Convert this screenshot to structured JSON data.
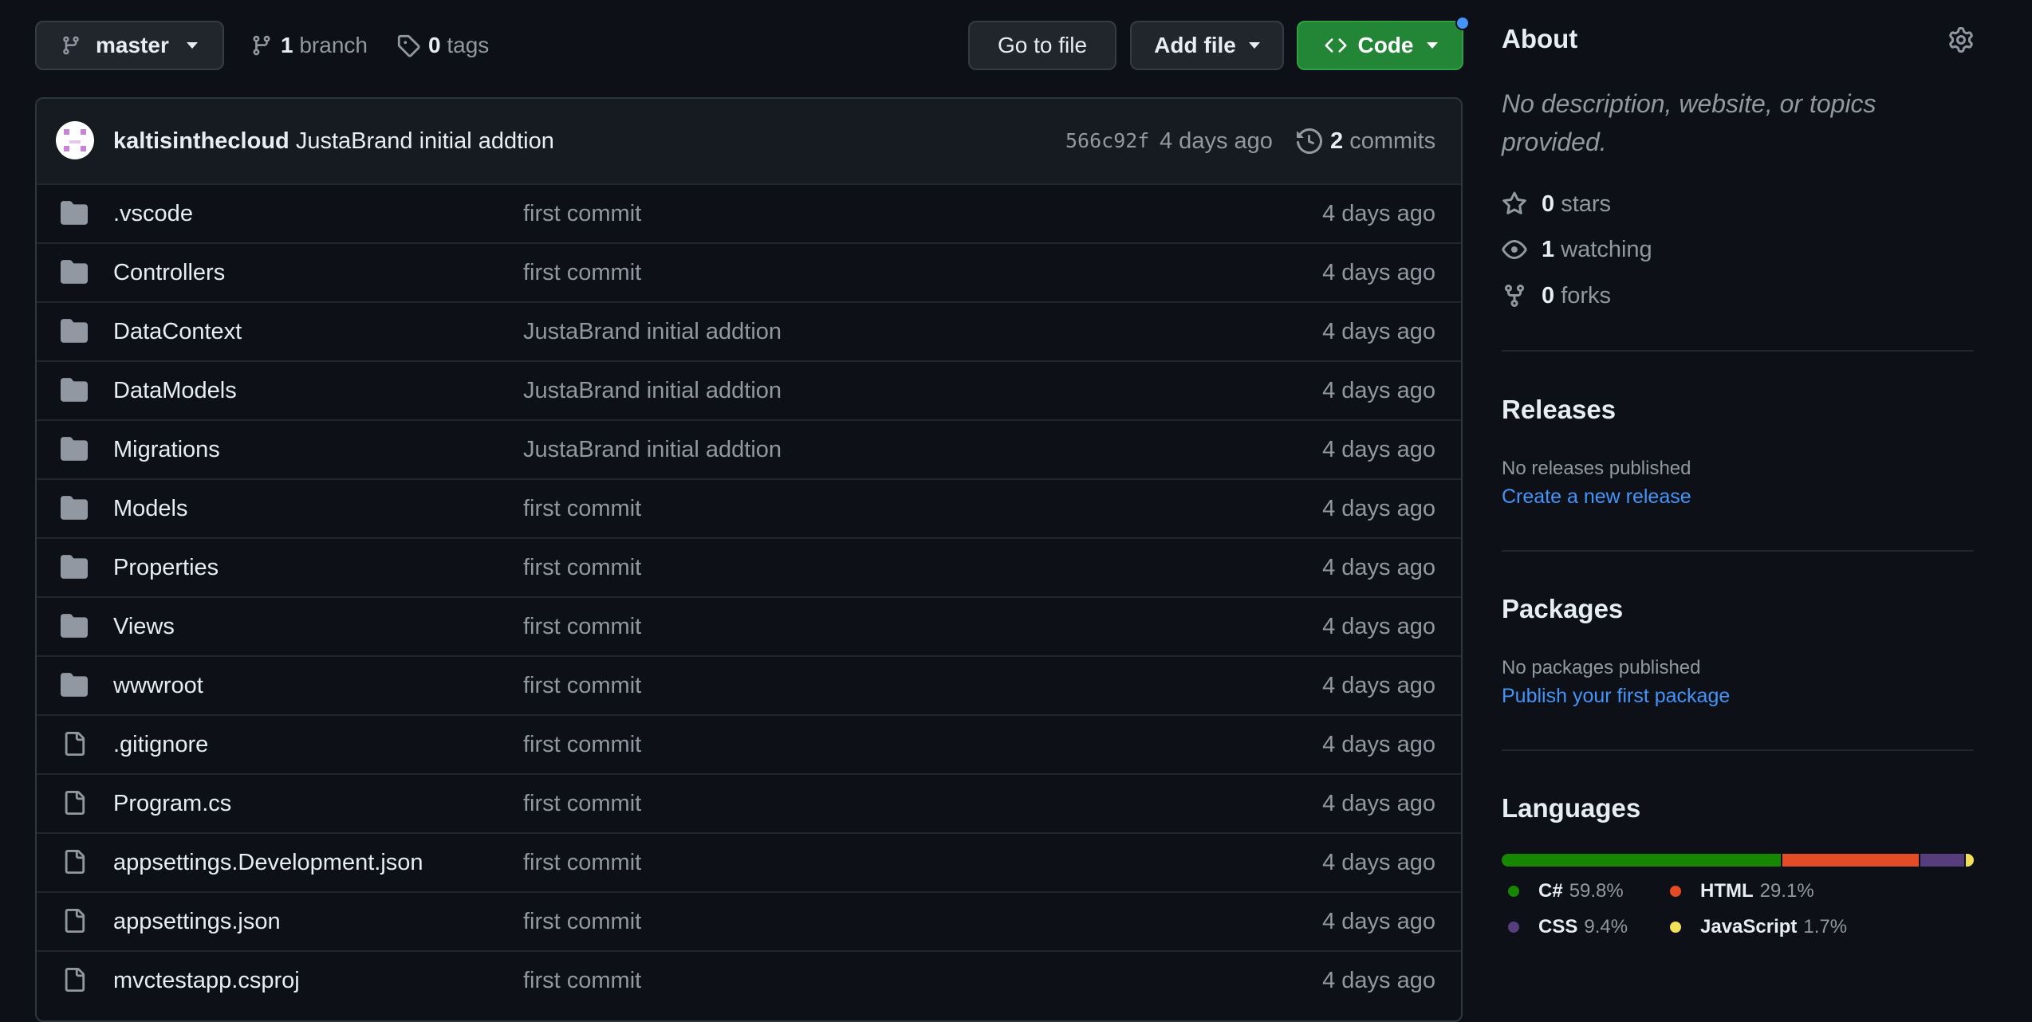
{
  "toolbar": {
    "branch": "master",
    "branches_count": "1",
    "branches_label": "branch",
    "tags_count": "0",
    "tags_label": "tags",
    "goto_file": "Go to file",
    "add_file": "Add file",
    "code": "Code"
  },
  "commit": {
    "author": "kaltisinthecloud",
    "message": "JustaBrand initial addtion",
    "sha": "566c92f",
    "time": "4 days ago",
    "commits_count": "2",
    "commits_label": "commits"
  },
  "files": [
    {
      "type": "folder",
      "name": ".vscode",
      "message": "first commit",
      "age": "4 days ago"
    },
    {
      "type": "folder",
      "name": "Controllers",
      "message": "first commit",
      "age": "4 days ago"
    },
    {
      "type": "folder",
      "name": "DataContext",
      "message": "JustaBrand initial addtion",
      "age": "4 days ago"
    },
    {
      "type": "folder",
      "name": "DataModels",
      "message": "JustaBrand initial addtion",
      "age": "4 days ago"
    },
    {
      "type": "folder",
      "name": "Migrations",
      "message": "JustaBrand initial addtion",
      "age": "4 days ago"
    },
    {
      "type": "folder",
      "name": "Models",
      "message": "first commit",
      "age": "4 days ago"
    },
    {
      "type": "folder",
      "name": "Properties",
      "message": "first commit",
      "age": "4 days ago"
    },
    {
      "type": "folder",
      "name": "Views",
      "message": "first commit",
      "age": "4 days ago"
    },
    {
      "type": "folder",
      "name": "wwwroot",
      "message": "first commit",
      "age": "4 days ago"
    },
    {
      "type": "file",
      "name": ".gitignore",
      "message": "first commit",
      "age": "4 days ago"
    },
    {
      "type": "file",
      "name": "Program.cs",
      "message": "first commit",
      "age": "4 days ago"
    },
    {
      "type": "file",
      "name": "appsettings.Development.json",
      "message": "first commit",
      "age": "4 days ago"
    },
    {
      "type": "file",
      "name": "appsettings.json",
      "message": "first commit",
      "age": "4 days ago"
    },
    {
      "type": "file",
      "name": "mvctestapp.csproj",
      "message": "first commit",
      "age": "4 days ago"
    }
  ],
  "about": {
    "title": "About",
    "description": "No description, website, or topics provided.",
    "stars_count": "0",
    "stars_label": "stars",
    "watching_count": "1",
    "watching_label": "watching",
    "forks_count": "0",
    "forks_label": "forks"
  },
  "releases": {
    "title": "Releases",
    "empty": "No releases published",
    "link": "Create a new release"
  },
  "packages": {
    "title": "Packages",
    "empty": "No packages published",
    "link": "Publish your first package"
  },
  "languages": {
    "title": "Languages",
    "items": [
      {
        "name": "C#",
        "percent": "59.8%",
        "value": 59.8,
        "color": "#178600"
      },
      {
        "name": "HTML",
        "percent": "29.1%",
        "value": 29.1,
        "color": "#e34c26"
      },
      {
        "name": "CSS",
        "percent": "9.4%",
        "value": 9.4,
        "color": "#563d7c"
      },
      {
        "name": "JavaScript",
        "percent": "1.7%",
        "value": 1.7,
        "color": "#f1e05a"
      }
    ]
  },
  "colors": {
    "background": "#0d1117",
    "accent_green": "#238636",
    "link_blue": "#4493f8",
    "muted_text": "#9198a1"
  },
  "icons": {
    "branch": "git-branch-icon",
    "tag": "tag-icon",
    "history": "history-icon",
    "folder": "folder-icon",
    "file": "file-icon",
    "gear": "gear-icon",
    "star": "star-icon",
    "eye": "eye-icon",
    "fork": "repo-forked-icon",
    "code": "code-icon"
  }
}
